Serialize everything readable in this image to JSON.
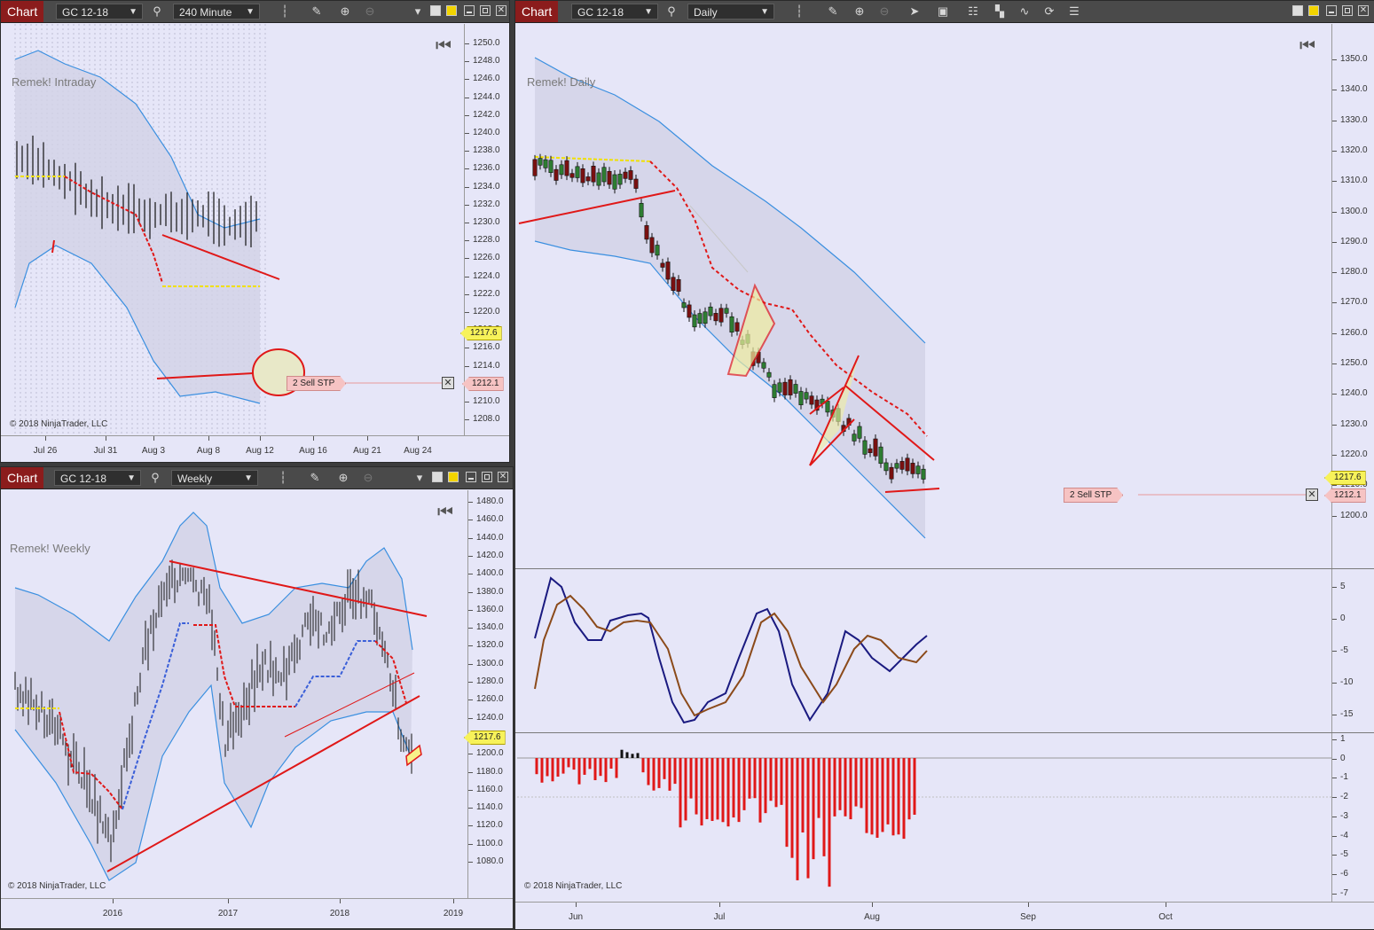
{
  "windows": {
    "intraday": {
      "chart_label": "Chart",
      "instrument": "GC 12-18",
      "interval": "240 Minute",
      "watermark": "Remek! Intraday",
      "copyright": "© 2018 NinjaTrader, LLC",
      "price_ticks": [
        "1250.0",
        "1248.0",
        "1246.0",
        "1244.0",
        "1242.0",
        "1240.0",
        "1238.0",
        "1236.0",
        "1234.0",
        "1232.0",
        "1230.0",
        "1228.0",
        "1226.0",
        "1224.0",
        "1222.0",
        "1220.0",
        "1218.0",
        "1216.0",
        "1214.0",
        "1212.0",
        "1210.0",
        "1208.0"
      ],
      "date_ticks": [
        "Jul 26",
        "Jul 31",
        "Aug 3",
        "Aug 8",
        "Aug 12",
        "Aug 16",
        "Aug 21",
        "Aug 24"
      ],
      "last_price": "1217.6",
      "order_price": "1212.1",
      "order_label": "2  Sell STP"
    },
    "weekly": {
      "chart_label": "Chart",
      "instrument": "GC 12-18",
      "interval": "Weekly",
      "watermark": "Remek! Weekly",
      "copyright": "© 2018 NinjaTrader, LLC",
      "price_ticks": [
        "1480.0",
        "1460.0",
        "1440.0",
        "1420.0",
        "1400.0",
        "1380.0",
        "1360.0",
        "1340.0",
        "1320.0",
        "1300.0",
        "1280.0",
        "1260.0",
        "1240.0",
        "1220.0",
        "1200.0",
        "1180.0",
        "1160.0",
        "1140.0",
        "1120.0",
        "1100.0",
        "1080.0"
      ],
      "date_ticks": [
        "2016",
        "2017",
        "2018",
        "2019"
      ],
      "last_price": "1217.6"
    },
    "daily": {
      "chart_label": "Chart",
      "instrument": "GC 12-18",
      "interval": "Daily",
      "watermark": "Remek! Daily",
      "copyright": "© 2018 NinjaTrader, LLC",
      "price_ticks": [
        "1350.0",
        "1340.0",
        "1330.0",
        "1320.0",
        "1310.0",
        "1300.0",
        "1290.0",
        "1280.0",
        "1270.0",
        "1260.0",
        "1250.0",
        "1240.0",
        "1230.0",
        "1220.0",
        "1210.0",
        "1200.0"
      ],
      "osc_ticks": [
        "5",
        "0",
        "-5",
        "-10",
        "-15"
      ],
      "hist_ticks": [
        "1",
        "0",
        "-1",
        "-2",
        "-3",
        "-4",
        "-5",
        "-6",
        "-7"
      ],
      "date_ticks": [
        "Jun",
        "Jul",
        "Aug",
        "Sep",
        "Oct"
      ],
      "last_price": "1217.6",
      "order_price": "1212.1",
      "order_label": "2  Sell STP"
    }
  },
  "colors": {
    "background": "#e6e6f8",
    "bull": "#2e7d32",
    "bear": "#7a1010",
    "trendline": "#e01818",
    "band": "#3a8fe0",
    "oscillator_fast": "#1a1a80",
    "oscillator_slow": "#8b4a1a",
    "histogram": "#e01818"
  },
  "icons": [
    "bars-icon",
    "pencil-icon",
    "zoom-in-icon",
    "zoom-out-icon",
    "search-icon",
    "pointer-icon",
    "data-box-icon",
    "properties-icon",
    "strategies-icon",
    "indicator-icon",
    "refresh-icon",
    "list-icon",
    "skip-to-end-icon",
    "close-icon",
    "maximize-icon",
    "minimize-icon",
    "color-square-icon"
  ]
}
